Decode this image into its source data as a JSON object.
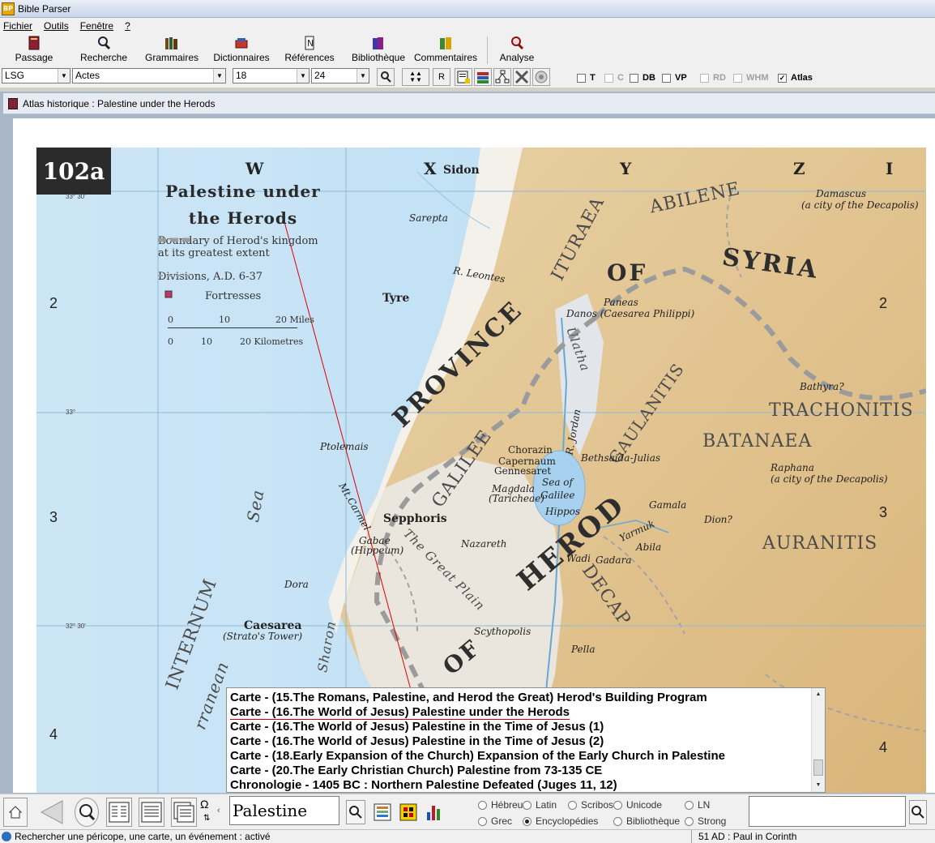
{
  "app": {
    "title": "Bible Parser",
    "icon": "bible-parser-icon"
  },
  "menu": [
    "Fichier",
    "Outils",
    "Fenêtre",
    "?"
  ],
  "toolbar": [
    {
      "label": "Passage",
      "icon": "book-icon"
    },
    {
      "label": "Recherche",
      "icon": "magnifier-icon"
    },
    {
      "label": "Grammaires",
      "icon": "books-icon"
    },
    {
      "label": "Dictionnaires",
      "icon": "dictionary-icon"
    },
    {
      "label": "Références",
      "icon": "references-icon"
    },
    {
      "label": "Bibliothèque",
      "icon": "library-icon"
    },
    {
      "label": "Commentaires",
      "icon": "comments-icon"
    },
    {
      "label": "Analyse",
      "icon": "analysis-icon"
    }
  ],
  "selectors": {
    "version": "LSG",
    "book": "Actes",
    "chapter": "18",
    "verse": "24",
    "r_label": "R"
  },
  "checks": [
    {
      "label": "T",
      "checked": false,
      "dim": false
    },
    {
      "label": "C",
      "checked": false,
      "dim": true
    },
    {
      "label": "DB",
      "checked": false,
      "dim": false
    },
    {
      "label": "VP",
      "checked": false,
      "dim": false
    },
    {
      "label": "RD",
      "checked": false,
      "dim": true
    },
    {
      "label": "WHM",
      "checked": false,
      "dim": true
    },
    {
      "label": "Atlas",
      "checked": true,
      "dim": false
    }
  ],
  "window": {
    "title": "Atlas historique : Palestine under the Herods"
  },
  "map": {
    "plate": "102a",
    "title_line1": "Palestine under",
    "title_line2": "the Herods",
    "legend": [
      {
        "line1": "Boundary of Herod's kingdom",
        "line2": "at its greatest extent"
      },
      {
        "line1": "Divisions, A.D. 6-37",
        "line2": ""
      },
      {
        "line1": "Fortresses",
        "line2": ""
      }
    ],
    "scale_miles": [
      "0",
      "10",
      "20 Miles"
    ],
    "scale_km": [
      "0",
      "10",
      "20 Kilometres"
    ],
    "grid_numbers": [
      "2",
      "3",
      "4"
    ],
    "grid_letters": [
      "W",
      "X",
      "Y",
      "Z",
      "I"
    ],
    "lat_labels": [
      "33° 30'",
      "33°",
      "32° 30'"
    ],
    "regions": {
      "syria": "SYRIA",
      "of_syria": "OF",
      "province": "PROVINCE",
      "abilene": "ABILENE",
      "ituraea": "ITURAEA",
      "gaulanitis": "GAULANITIS",
      "trachonitis": "TRACHONITIS",
      "batanaea": "BATANAEA",
      "auranitis": "AURANITIS",
      "galilee": "GALILEE",
      "herod": "HEROD",
      "of_herod": "OF",
      "decapolis": "DECAP",
      "mare": "INTERNUM",
      "sea": "Sea",
      "mare2": "rranean",
      "sharon": "Sharon",
      "great_plain": "The Great Plain",
      "ulatha": "Ulatha"
    },
    "places": {
      "sidon": "Sidon",
      "sarepta": "Sarepta",
      "damascus": "Damascus",
      "damascus_note": "(a city of the Decapolis)",
      "leontes": "R. Leontes",
      "tyre": "Tyre",
      "paneas": "Paneas",
      "danos": "Danos (Caesarea Philippi)",
      "bathyra": "Bathyra?",
      "ptolemais": "Ptolemais",
      "chorazin": "Chorazin",
      "capernaum": "Capernaum",
      "gennesaret": "Gennesaret",
      "bethsaida": "Bethsaida-Julias",
      "magdala": "Magdala",
      "tarichea": "(Taricheae)",
      "sea_galilee": "Sea of",
      "galilee_word": "Galilee",
      "hippos": "Hippos",
      "raphana": "Raphana",
      "raphana_note": "(a city of the Decapolis)",
      "gamala": "Gamala",
      "dion": "Dion?",
      "sepphoris": "Sepphoris",
      "gabae": "Gabae",
      "hippeum": "(Hippeum)",
      "nazareth": "Nazareth",
      "abila": "Abila",
      "yarmuk": "Yarmuk",
      "gadara": "Gadara",
      "wadi": "Wadi",
      "dora": "Dora",
      "caesarea": "Caesarea",
      "stratos": "(Strato's Tower)",
      "scythopolis": "Scythopolis",
      "pella": "Pella",
      "carmel": "Mt.Carmel",
      "jordan": "R. Jordan"
    }
  },
  "popup": {
    "items": [
      "Carte - (15.The Romans, Palestine, and Herod the Great) Herod's Building Program",
      "Carte - (16.The World of Jesus) Palestine under the Herods",
      "Carte - (16.The World of Jesus) Palestine in the Time of Jesus (1)",
      "Carte - (16.The World of Jesus) Palestine in the Time of Jesus (2)",
      "Carte - (18.Early Expansion of the Church) Expansion of the Early Church in Palestine",
      "Carte - (20.The Early Christian Church) Palestine from 73-135 CE",
      "Chronologie - 1405 BC : Northern Palestine Defeated (Juges 11, 12)"
    ],
    "selected_index": 1
  },
  "bottom": {
    "search_value": "Palestine",
    "omega": "Ω",
    "radios": [
      {
        "label": "Hébreu",
        "on": false
      },
      {
        "label": "Latin",
        "on": false
      },
      {
        "label": "Scribos",
        "on": false
      },
      {
        "label": "Unicode",
        "on": false
      },
      {
        "label": "LN",
        "on": false
      },
      {
        "label": "Grec",
        "on": false
      },
      {
        "label": "Encyclopédies",
        "on": true
      },
      {
        "label": "Bibliothèque",
        "on": false
      },
      {
        "label": "Strong",
        "on": false
      }
    ]
  },
  "status": {
    "left": "Rechercher une péricope, une carte, un événement : activé",
    "right": "51 AD : Paul in Corinth"
  }
}
